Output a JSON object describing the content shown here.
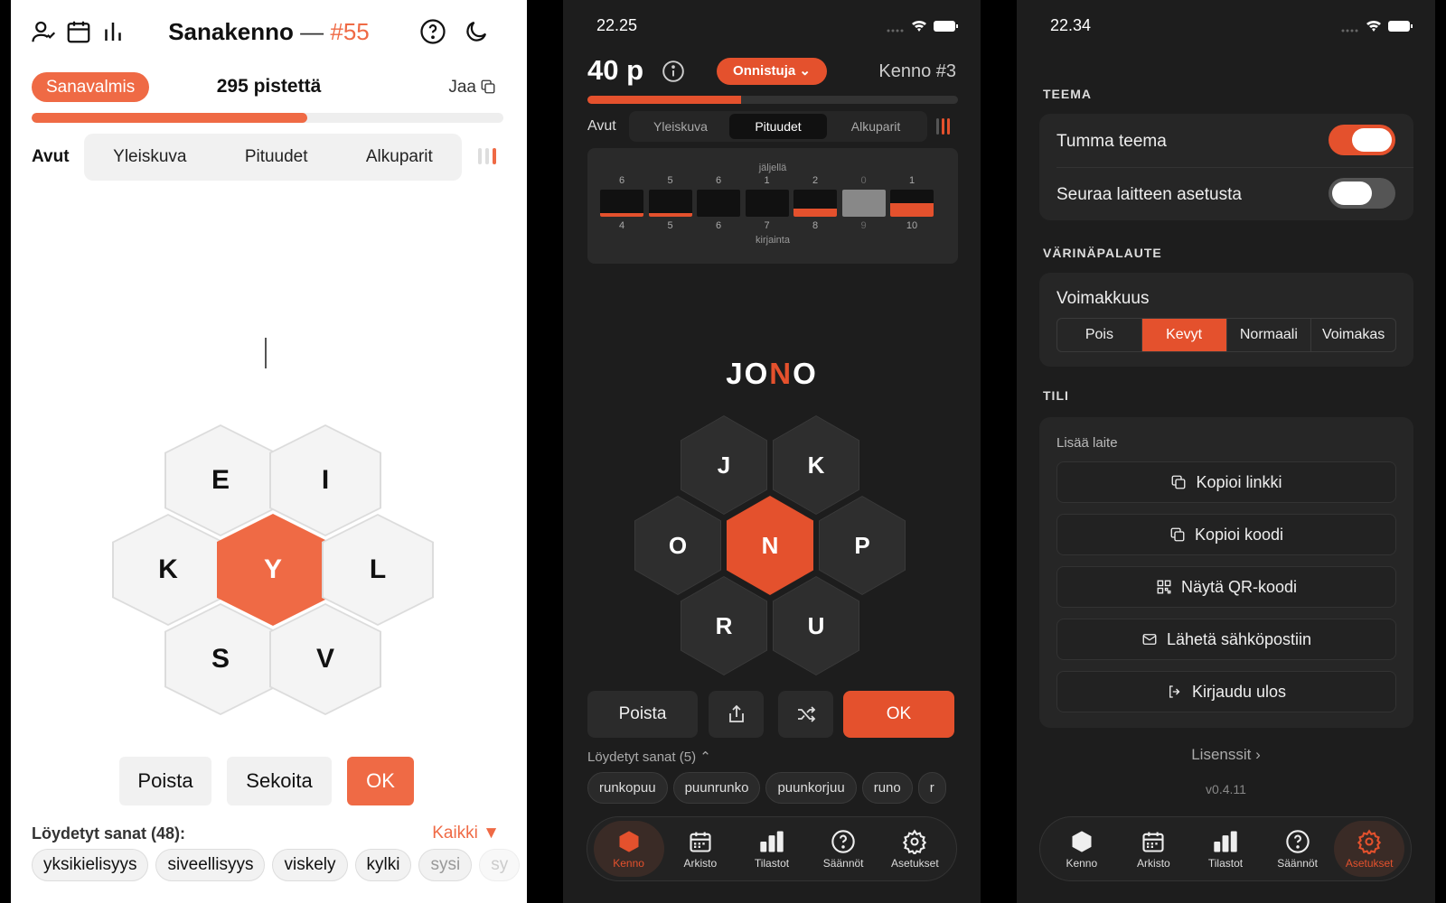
{
  "light": {
    "title": "Sanakenno",
    "title_dash": "—",
    "puzzle_number": "#55",
    "rank": "Sanavalmis",
    "score": "295 pistettä",
    "share_label": "Jaa",
    "progress": 0.585,
    "hints_label": "Avut",
    "hint_tabs": [
      "Yleiskuva",
      "Pituudet",
      "Alkuparit"
    ],
    "letters": {
      "center": "Y",
      "outer": [
        "E",
        "I",
        "K",
        "L",
        "S",
        "V"
      ]
    },
    "buttons": {
      "delete": "Poista",
      "shuffle": "Sekoita",
      "ok": "OK"
    },
    "found_label": "Löydetyt sanat (48):",
    "filter_label": "Kaikki ▼",
    "found_words": [
      "yksikielisyys",
      "siveellisyys",
      "viskely",
      "kylki",
      "sysi",
      "sy"
    ],
    "icons": [
      "user-check-icon",
      "calendar-icon",
      "bar-chart-icon",
      "help-circle-icon",
      "moon-icon",
      "copy-icon"
    ]
  },
  "game": {
    "time": "22.25",
    "points": "40 p",
    "rank": "Onnistuja",
    "puzzle_label": "Kenno #3",
    "progress": 0.415,
    "hints_label": "Avut",
    "hint_tabs": [
      "Yleiskuva",
      "Pituudet",
      "Alkuparit"
    ],
    "active_tab": "Pituudet",
    "lengths_top": "jäljellä",
    "lengths_bottom": "kirjainta",
    "lengths": [
      {
        "len": "4",
        "left": "6",
        "fill": 0.15
      },
      {
        "len": "5",
        "left": "5",
        "fill": 0.15
      },
      {
        "len": "6",
        "left": "6",
        "fill": 0
      },
      {
        "len": "7",
        "left": "1",
        "fill": 0
      },
      {
        "len": "8",
        "left": "2",
        "fill": 0.3
      },
      {
        "len": "9",
        "left": "0",
        "fill": 1,
        "done": true
      },
      {
        "len": "10",
        "left": "1",
        "fill": 0.5
      }
    ],
    "word_parts": [
      "JO",
      "N",
      "O"
    ],
    "letters": {
      "center": "N",
      "outer": [
        "J",
        "K",
        "O",
        "P",
        "R",
        "U"
      ]
    },
    "buttons": {
      "delete": "Poista",
      "ok": "OK"
    },
    "found_label": "Löydetyt sanat (5)",
    "found_words": [
      "runkopuu",
      "puunrunko",
      "puunkorjuu",
      "runo",
      "r"
    ],
    "tabs": [
      "Kenno",
      "Arkisto",
      "Tilastot",
      "Säännöt",
      "Asetukset"
    ],
    "accent": "#e4512d"
  },
  "settings": {
    "time": "22.34",
    "theme_header": "TEEMA",
    "dark_theme": "Tumma teema",
    "follow_device": "Seuraa laitteen asetusta",
    "dark_theme_on": true,
    "follow_device_on": false,
    "haptic_header": "VÄRINÄPALAUTE",
    "intensity_label": "Voimakkuus",
    "intensity_options": [
      "Pois",
      "Kevyt",
      "Normaali",
      "Voimakas"
    ],
    "intensity_selected": "Kevyt",
    "account_header": "TILI",
    "add_device": "Lisää laite",
    "actions": [
      "Kopioi linkki",
      "Kopioi koodi",
      "Näytä QR-koodi",
      "Lähetä sähköpostiin",
      "Kirjaudu ulos"
    ],
    "licenses": "Lisenssit",
    "version": "v0.4.11",
    "tabs": [
      "Kenno",
      "Arkisto",
      "Tilastot",
      "Säännöt",
      "Asetukset"
    ]
  }
}
